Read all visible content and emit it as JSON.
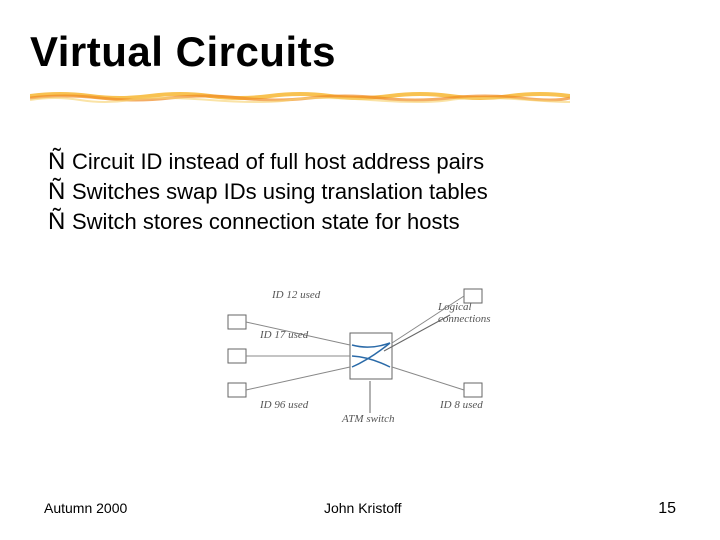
{
  "title": "Virtual Circuits",
  "bullets": [
    "Circuit ID instead of full host address pairs",
    "Switches swap IDs using translation tables",
    "Switch stores connection state for hosts"
  ],
  "diagram": {
    "labels": {
      "id12": "ID 12 used",
      "id17": "ID 17 used",
      "id96": "ID 96 used",
      "id8": "ID 8 used",
      "atm": "ATM switch",
      "logical": "Logical connections"
    }
  },
  "footer": {
    "left": "Autumn 2000",
    "center": "John Kristoff",
    "right": "15"
  },
  "bullet_glyph": "Ñ"
}
